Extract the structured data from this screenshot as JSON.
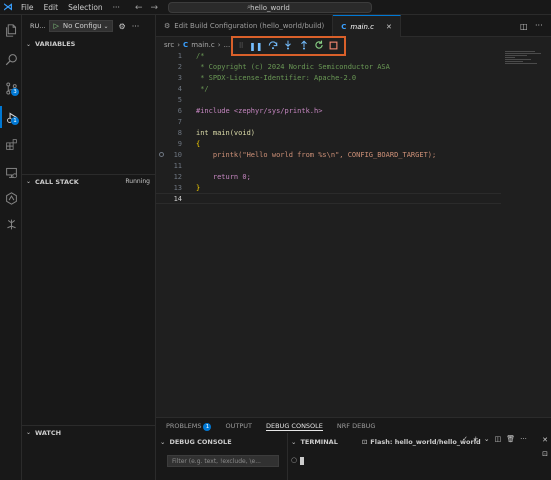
{
  "titlebar": {
    "menu": [
      "File",
      "Edit",
      "Selection"
    ],
    "search_text": "hello_world"
  },
  "sidebar": {
    "title": "RU...",
    "run_config": "No Configu",
    "sections": {
      "variables": "VARIABLES",
      "call_stack": "CALL STACK",
      "call_stack_state": "Running",
      "watch": "WATCH"
    }
  },
  "activity": {
    "source_control_badge": "3",
    "debug_badge": "1"
  },
  "tabs": [
    {
      "label": "Edit Build Configuration (hello_world/build)",
      "active": false
    },
    {
      "label": "main.c",
      "active": true
    }
  ],
  "breadcrumb": [
    "src",
    "main.c",
    "..."
  ],
  "editor": {
    "lines": [
      {
        "n": "1",
        "code": "/*"
      },
      {
        "n": "2",
        "code": " * Copyright (c) 2024 Nordic Semiconductor ASA"
      },
      {
        "n": "3",
        "code": " * SPDX-License-Identifier: Apache-2.0"
      },
      {
        "n": "4",
        "code": " */"
      },
      {
        "n": "5",
        "code": ""
      },
      {
        "n": "6",
        "code": "#include <zephyr/sys/printk.h>"
      },
      {
        "n": "7",
        "code": ""
      },
      {
        "n": "8",
        "code": "int main(void)"
      },
      {
        "n": "9",
        "code": "{"
      },
      {
        "n": "10",
        "code": "    printk(\"Hello world from %s\\n\", CONFIG_BOARD_TARGET);"
      },
      {
        "n": "11",
        "code": ""
      },
      {
        "n": "12",
        "code": "    return 0;"
      },
      {
        "n": "13",
        "code": "}"
      },
      {
        "n": "14",
        "code": ""
      }
    ]
  },
  "panel": {
    "tabs": [
      "PROBLEMS",
      "OUTPUT",
      "DEBUG CONSOLE",
      "NRF DEBUG"
    ],
    "problems_badge": "1",
    "debug_console_title": "DEBUG CONSOLE",
    "terminal_title": "TERMINAL",
    "terminal_name": "Flash: hello_world/hello_world",
    "filter_placeholder": "Filter (e.g. text, !exclude, \\e..."
  },
  "colors": {
    "accent": "#0078d4",
    "highlight_box": "#d9602a"
  }
}
